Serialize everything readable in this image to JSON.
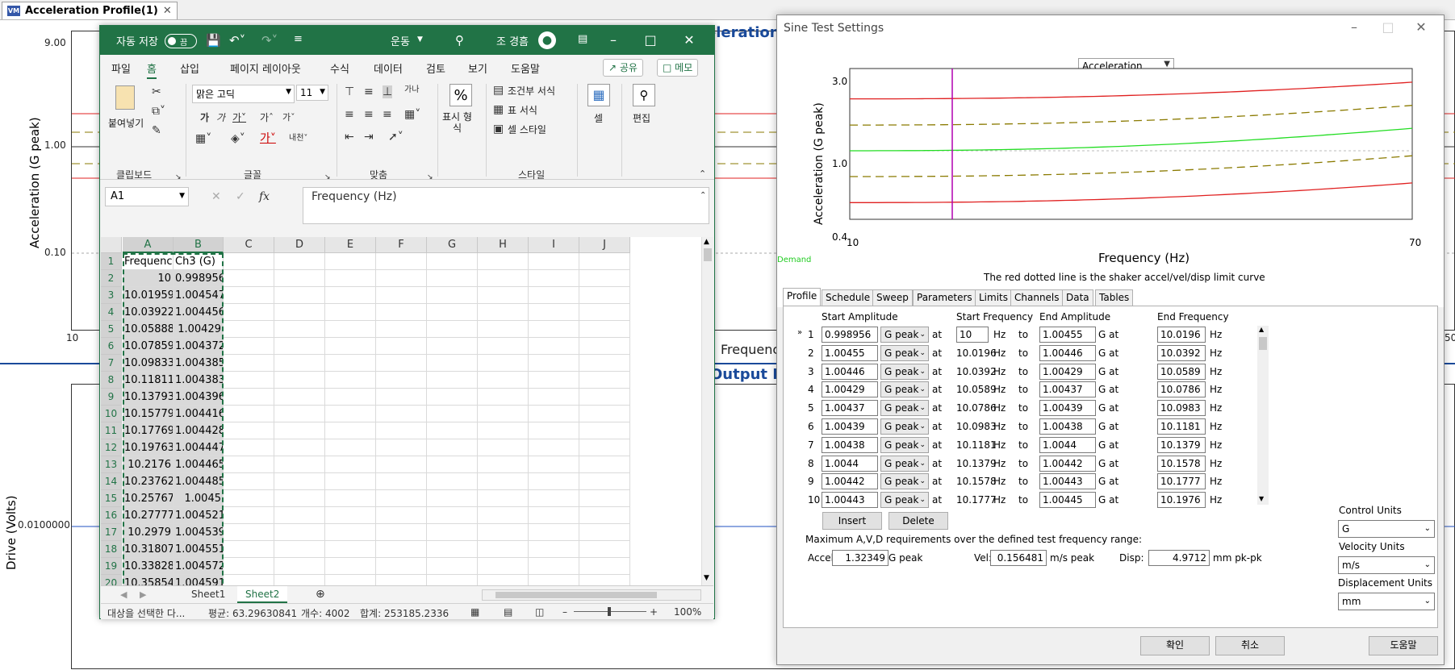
{
  "bg": {
    "tab_title": "Acceleration Profile(1)",
    "tab_logo": "VM",
    "tab_close": "✕",
    "top_plot": {
      "ylabel": "Acceleration (G peak)",
      "y_ticks": [
        "9.00",
        "1.00",
        "0.10"
      ],
      "x_start": "10",
      "x_end": "50",
      "title_fragment": "eleration",
      "xlabel_fragment": "Frequency"
    },
    "bottom_plot": {
      "title_fragment": "Output Dr",
      "ylabel": "Drive (Volts)",
      "y_tick": "0.0100000"
    }
  },
  "excel": {
    "title": {
      "autosave": "자동 저장",
      "toggle": "끔",
      "doc_name": "운동",
      "user": "조 경흠"
    },
    "menu": [
      "파일",
      "홈",
      "삽입",
      "페이지 레이아웃",
      "수식",
      "데이터",
      "검토",
      "보기",
      "도움말"
    ],
    "share": "공유",
    "memo": "메모",
    "ribbon": {
      "clipboard_paste": "붙여넣기",
      "clipboard_label": "클립보드",
      "font_name": "맑은 고딕",
      "font_size": "11",
      "font_label": "글꼴",
      "align_label": "맞춤",
      "number_label": "표시 형식",
      "number_btn": "표시 형\n식",
      "cond_format": "조건부 서식",
      "table_format": "표 서식",
      "cell_style": "셀 스타일",
      "style_label": "스타일",
      "cells": "셀",
      "edit": "편집"
    },
    "formula_bar": {
      "name_box": "A1",
      "fx": "fx",
      "content": "Frequency (Hz)"
    },
    "columns": [
      "A",
      "B",
      "C",
      "D",
      "E",
      "F",
      "G",
      "H",
      "I",
      "J"
    ],
    "rows": [
      [
        "1",
        "Frequency",
        "Ch3 (G)"
      ],
      [
        "2",
        "10",
        "0.998956"
      ],
      [
        "3",
        "10.01959",
        "1.004547"
      ],
      [
        "4",
        "10.03922",
        "1.004456"
      ],
      [
        "5",
        "10.05888",
        "1.00429"
      ],
      [
        "6",
        "10.07859",
        "1.004372"
      ],
      [
        "7",
        "10.09833",
        "1.004385"
      ],
      [
        "8",
        "10.11811",
        "1.004383"
      ],
      [
        "9",
        "10.13793",
        "1.004396"
      ],
      [
        "10",
        "10.15779",
        "1.004416"
      ],
      [
        "11",
        "10.17769",
        "1.004428"
      ],
      [
        "12",
        "10.19763",
        "1.004447"
      ],
      [
        "13",
        "10.2176",
        "1.004465"
      ],
      [
        "14",
        "10.23762",
        "1.004485"
      ],
      [
        "15",
        "10.25767",
        "1.0045"
      ],
      [
        "16",
        "10.27777",
        "1.004521"
      ],
      [
        "17",
        "10.2979",
        "1.004539"
      ],
      [
        "18",
        "10.31807",
        "1.004551"
      ],
      [
        "19",
        "10.33828",
        "1.004572"
      ],
      [
        "20",
        "10.35854",
        "1.004591"
      ]
    ],
    "sheets": [
      "Sheet1",
      "Sheet2"
    ],
    "status": {
      "mode": "대상을 선택한 다...",
      "average": "평균: 63.29630841",
      "count": "개수: 4002",
      "sum": "합계: 253185.2336",
      "zoom": "100%"
    }
  },
  "dialog": {
    "title": "Sine Test Settings",
    "plot_select": "Acceleration",
    "y_axis_label": "Acceleration (G peak)",
    "y_ticks": [
      "3.0",
      "1.0",
      "0.4"
    ],
    "x_ticks": [
      "10",
      "70"
    ],
    "x_axis_label": "Frequency (Hz)",
    "legend_demand": "Demand",
    "limit_note": "The red dotted line is the shaker accel/vel/disp limit curve",
    "tabs": [
      "Profile",
      "Schedule",
      "Sweep",
      "Parameters",
      "Limits",
      "Channels",
      "Data",
      "Tables"
    ],
    "active_tab": "Profile",
    "headers": {
      "start_amp": "Start Amplitude",
      "start_freq": "Start Frequency",
      "end_amp": "End Amplitude",
      "end_freq": "End Frequency"
    },
    "row_marker": "»",
    "at": "at",
    "hz": "Hz",
    "to": "to",
    "g_at": "G at",
    "profile_rows": [
      {
        "n": "1",
        "start_amp": "0.998956",
        "unit": "G peak",
        "start_freq": "10",
        "end_amp": "1.00455",
        "end_freq": "10.0196"
      },
      {
        "n": "2",
        "start_amp": "1.00455",
        "unit": "G peak",
        "start_freq": "10.0196",
        "end_amp": "1.00446",
        "end_freq": "10.0392"
      },
      {
        "n": "3",
        "start_amp": "1.00446",
        "unit": "G peak",
        "start_freq": "10.0392",
        "end_amp": "1.00429",
        "end_freq": "10.0589"
      },
      {
        "n": "4",
        "start_amp": "1.00429",
        "unit": "G peak",
        "start_freq": "10.0589",
        "end_amp": "1.00437",
        "end_freq": "10.0786"
      },
      {
        "n": "5",
        "start_amp": "1.00437",
        "unit": "G peak",
        "start_freq": "10.0786",
        "end_amp": "1.00439",
        "end_freq": "10.0983"
      },
      {
        "n": "6",
        "start_amp": "1.00439",
        "unit": "G peak",
        "start_freq": "10.0983",
        "end_amp": "1.00438",
        "end_freq": "10.1181"
      },
      {
        "n": "7",
        "start_amp": "1.00438",
        "unit": "G peak",
        "start_freq": "10.1181",
        "end_amp": "1.0044",
        "end_freq": "10.1379"
      },
      {
        "n": "8",
        "start_amp": "1.0044",
        "unit": "G peak",
        "start_freq": "10.1379",
        "end_amp": "1.00442",
        "end_freq": "10.1578"
      },
      {
        "n": "9",
        "start_amp": "1.00442",
        "unit": "G peak",
        "start_freq": "10.1578",
        "end_amp": "1.00443",
        "end_freq": "10.1777"
      },
      {
        "n": "10",
        "start_amp": "1.00443",
        "unit": "G peak",
        "start_freq": "10.1777",
        "end_amp": "1.00445",
        "end_freq": "10.1976"
      }
    ],
    "insert_btn": "Insert",
    "delete_btn": "Delete",
    "max_note": "Maximum A,V,D requirements over the defined test frequency range:",
    "accel_label": "Accel:",
    "accel_value": "1.32349",
    "accel_unit": "G peak",
    "vel_label": "Vel:",
    "vel_value": "0.156481",
    "vel_unit": "m/s peak",
    "disp_label": "Disp:",
    "disp_value": "4.9712",
    "disp_unit": "mm pk-pk",
    "control_units_label": "Control Units",
    "control_units": "G",
    "velocity_units_label": "Velocity Units",
    "velocity_units": "m/s",
    "disp_units_label": "Displacement Units",
    "disp_units": "mm",
    "ok": "확인",
    "cancel": "취소",
    "help": "도움말",
    "colors": {
      "limit_red": "#e02020",
      "demand_green": "#22dd22",
      "tolerance_olive": "#8a7a00",
      "cursor_magenta": "#b000b0"
    }
  }
}
